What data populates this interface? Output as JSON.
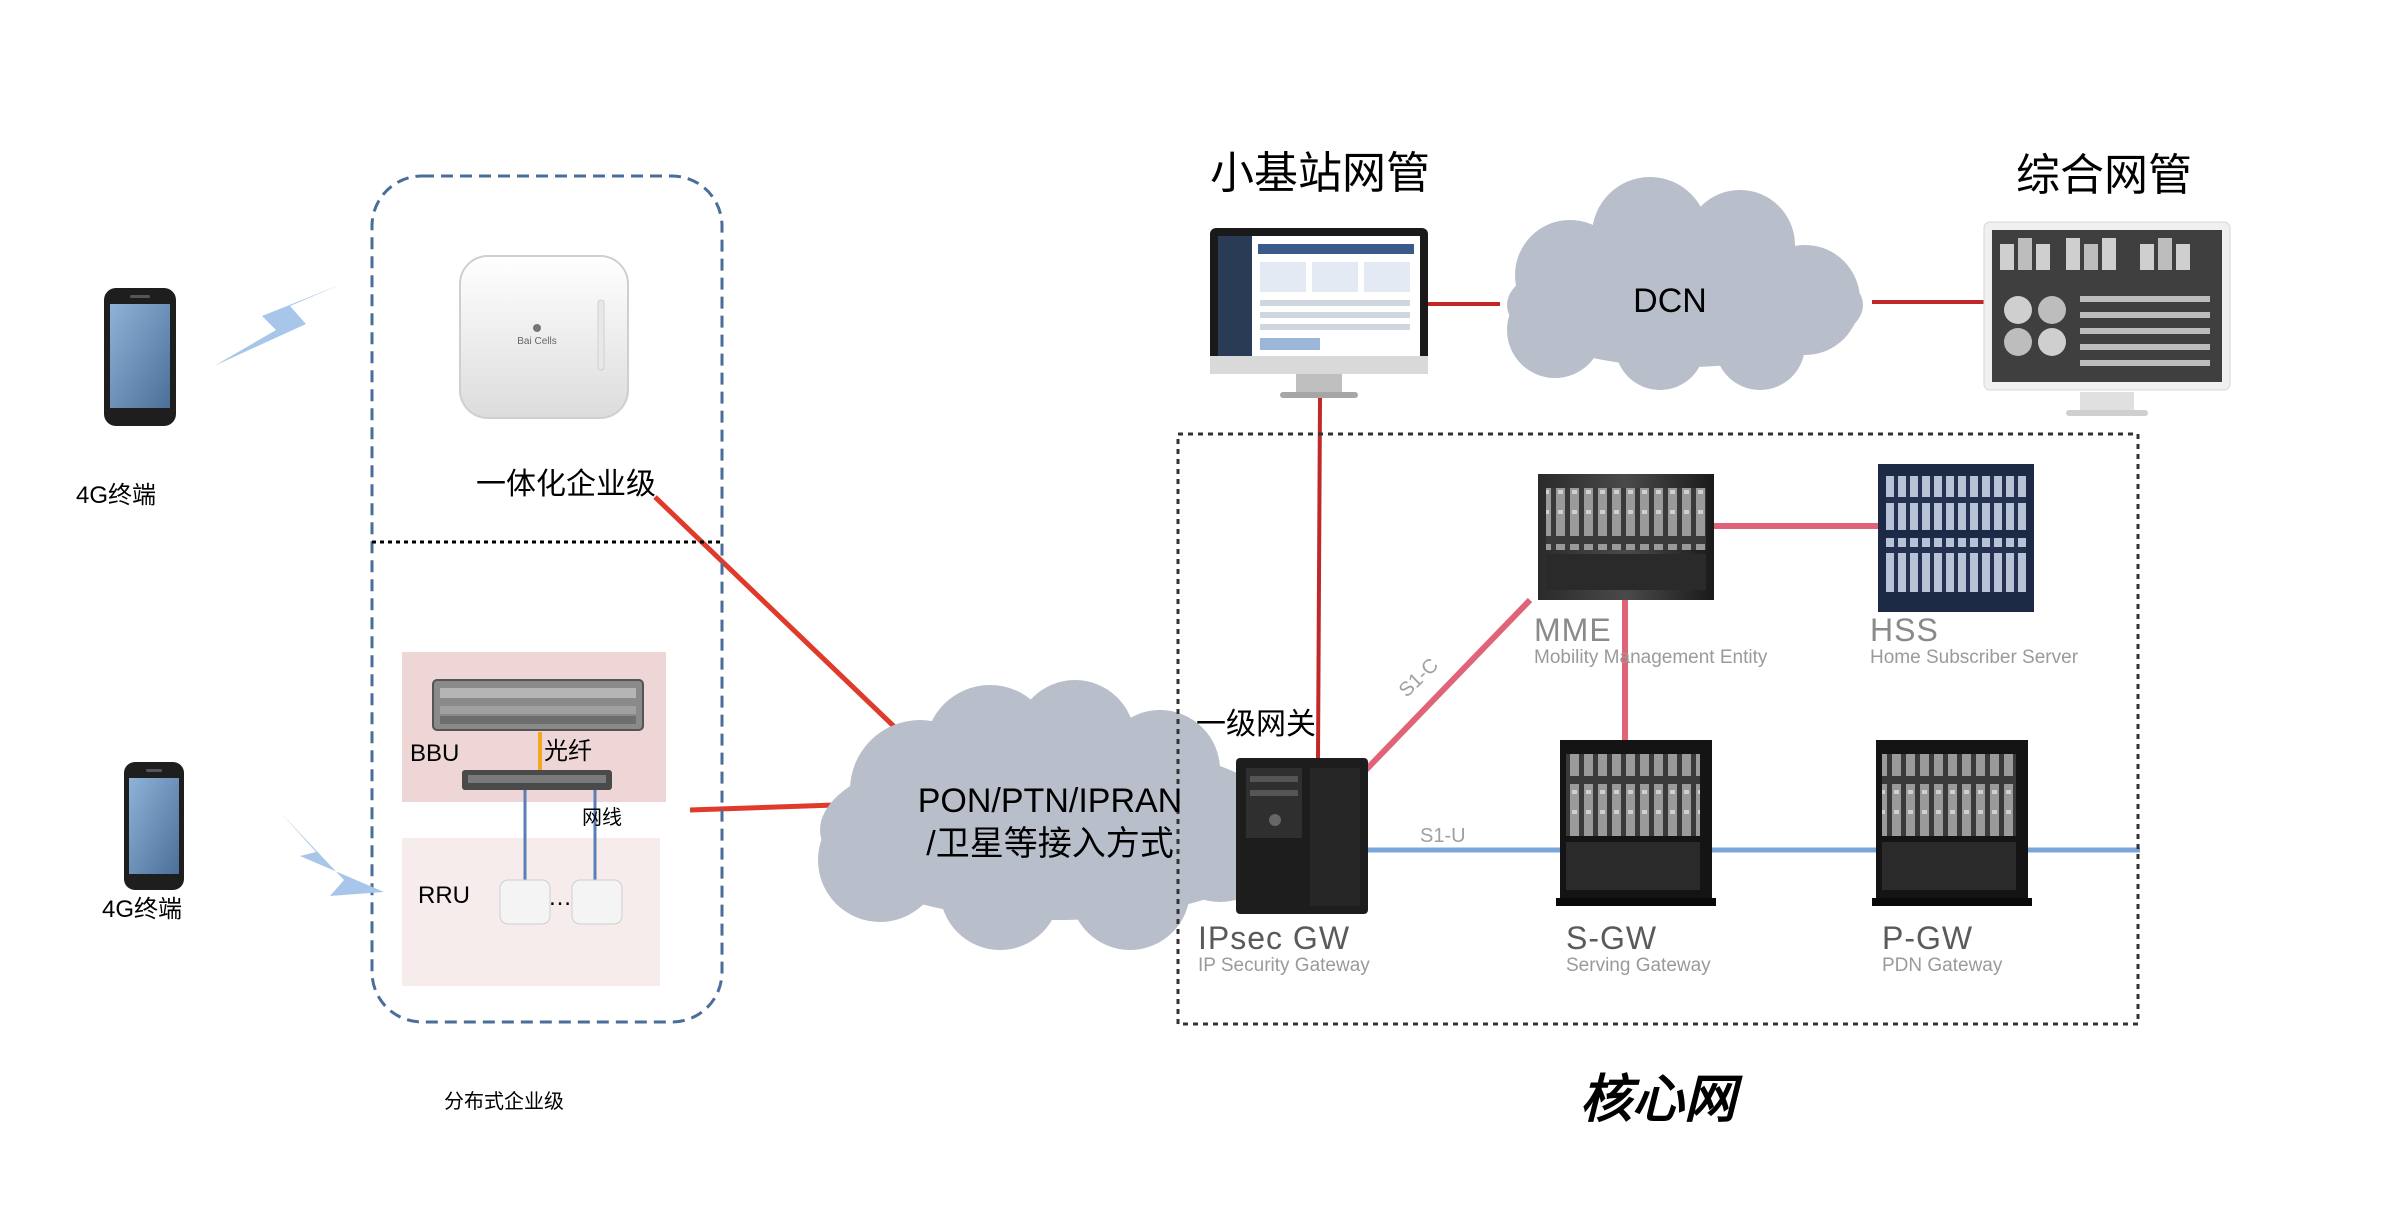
{
  "terminal_top": {
    "label": "4G终端"
  },
  "terminal_bottom": {
    "label": "4G终端"
  },
  "enterprise_box": {
    "integrated_label": "一体化企业级",
    "distributed_label": "分布式企业级",
    "bbu_label": "BBU",
    "fiber_label": "光纤",
    "cable_label": "网线",
    "rru_label": "RRU",
    "ellipsis": "…",
    "device_brand": "Bai Cells"
  },
  "access_cloud": {
    "line1": "PON/PTN/IPRAN",
    "line2": "/卫星等接入方式"
  },
  "dcn_cloud": {
    "label": "DCN"
  },
  "small_cell_nms": {
    "label": "小基站网管"
  },
  "integrated_nms": {
    "label": "综合网管"
  },
  "core": {
    "title": "核心网",
    "gateway_label": "一级网关",
    "s1c_label": "S1-C",
    "s1u_label": "S1-U",
    "entities": [
      {
        "name": "MME",
        "full": "Mobility Management Entity"
      },
      {
        "name": "HSS",
        "full": "Home Subscriber Server"
      },
      {
        "name": "IPsec GW",
        "full": "IP Security Gateway"
      },
      {
        "name": "S-GW",
        "full": "Serving Gateway"
      },
      {
        "name": "P-GW",
        "full": "PDN Gateway"
      }
    ]
  },
  "colors": {
    "red_link": "#e03a2b",
    "pink_link": "#e06478",
    "blue_link": "#7aa6dc",
    "dashed_box": "#4a6e9a",
    "cloud": "#b9bfca",
    "bbu_bg": "#efd6d6",
    "rru_bg": "#f7ecec"
  }
}
